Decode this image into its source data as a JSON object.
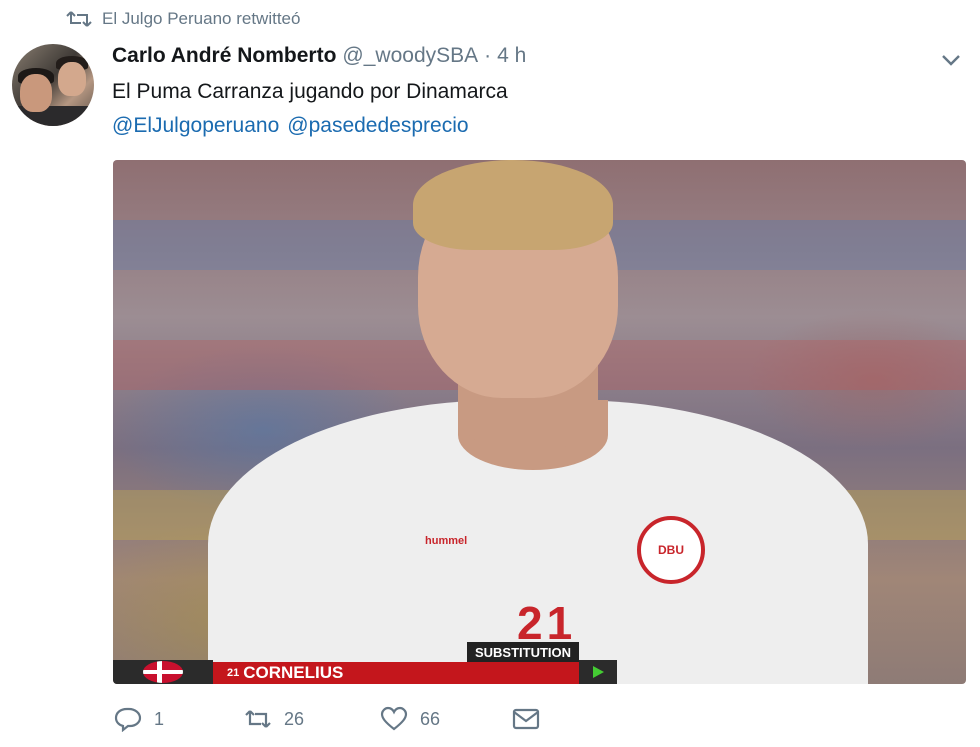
{
  "retweet_context": {
    "text": "El Julgo Peruano retwitteó",
    "icon": "retweet-icon"
  },
  "tweet": {
    "display_name": "Carlo André Nomberto",
    "handle": "@_woodySBA",
    "separator": "·",
    "time": "4 h",
    "text": "El Puma Carranza jugando por Dinamarca",
    "mentions": [
      "@ElJulgoperuano",
      "@pasededesprecio"
    ],
    "caret_icon": "chevron-down-icon"
  },
  "media": {
    "overlay": {
      "label": "SUBSTITUTION",
      "player_number": "21",
      "player_name": "CORNELIUS",
      "jersey_number": "21"
    }
  },
  "actions": {
    "reply_count": "1",
    "retweet_count": "26",
    "like_count": "66",
    "icons": [
      "reply-icon",
      "retweet-icon",
      "heart-icon",
      "mail-icon"
    ]
  },
  "colors": {
    "link": "#1b6bb0",
    "muted": "#657786",
    "text": "#14171a",
    "overlay_red": "#c4161c"
  }
}
